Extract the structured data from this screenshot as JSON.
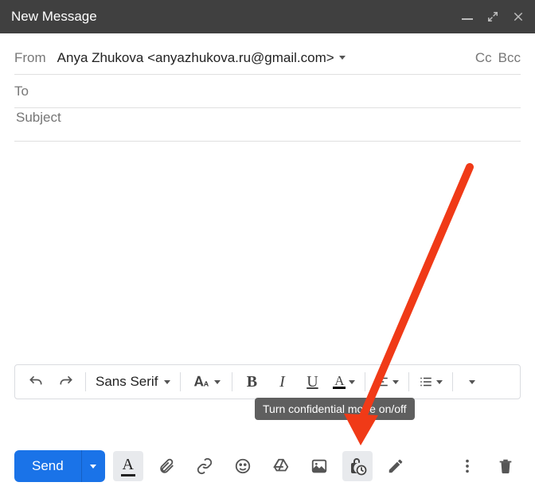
{
  "titlebar": {
    "title": "New Message"
  },
  "fields": {
    "from_label": "From",
    "from_value": "Anya Zhukova <anyazhukova.ru@gmail.com>",
    "cc_label": "Cc",
    "bcc_label": "Bcc",
    "to_label": "To",
    "to_value": "",
    "subject_placeholder": "Subject",
    "subject_value": ""
  },
  "format_toolbar": {
    "font_family": "Sans Serif",
    "bold": "B",
    "italic": "I",
    "underline": "U"
  },
  "actions": {
    "send_label": "Send",
    "formatting_glyph": "A"
  },
  "tooltip": {
    "confidential": "Turn confidential mode on/off"
  }
}
